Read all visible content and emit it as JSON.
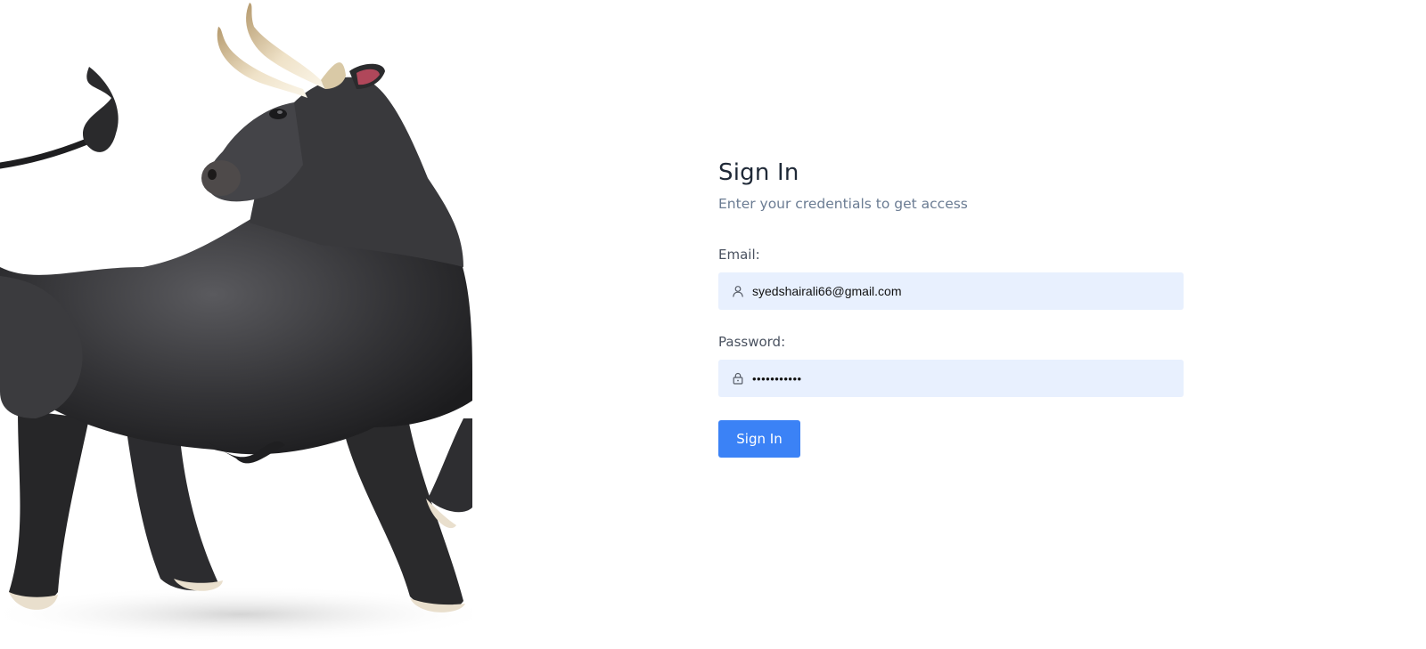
{
  "form": {
    "title": "Sign In",
    "subtitle": "Enter your credentials to get access",
    "email_label": "Email:",
    "email_value": "syedshairali66@gmail.com",
    "password_label": "Password:",
    "password_value": "sairali6600",
    "submit_label": "Sign In"
  },
  "icons": {
    "email_icon": "user-icon",
    "password_icon": "lock-icon"
  },
  "colors": {
    "primary": "#3b82f6",
    "input_bg": "#e8f0fe",
    "subtitle": "#6b7c93"
  }
}
